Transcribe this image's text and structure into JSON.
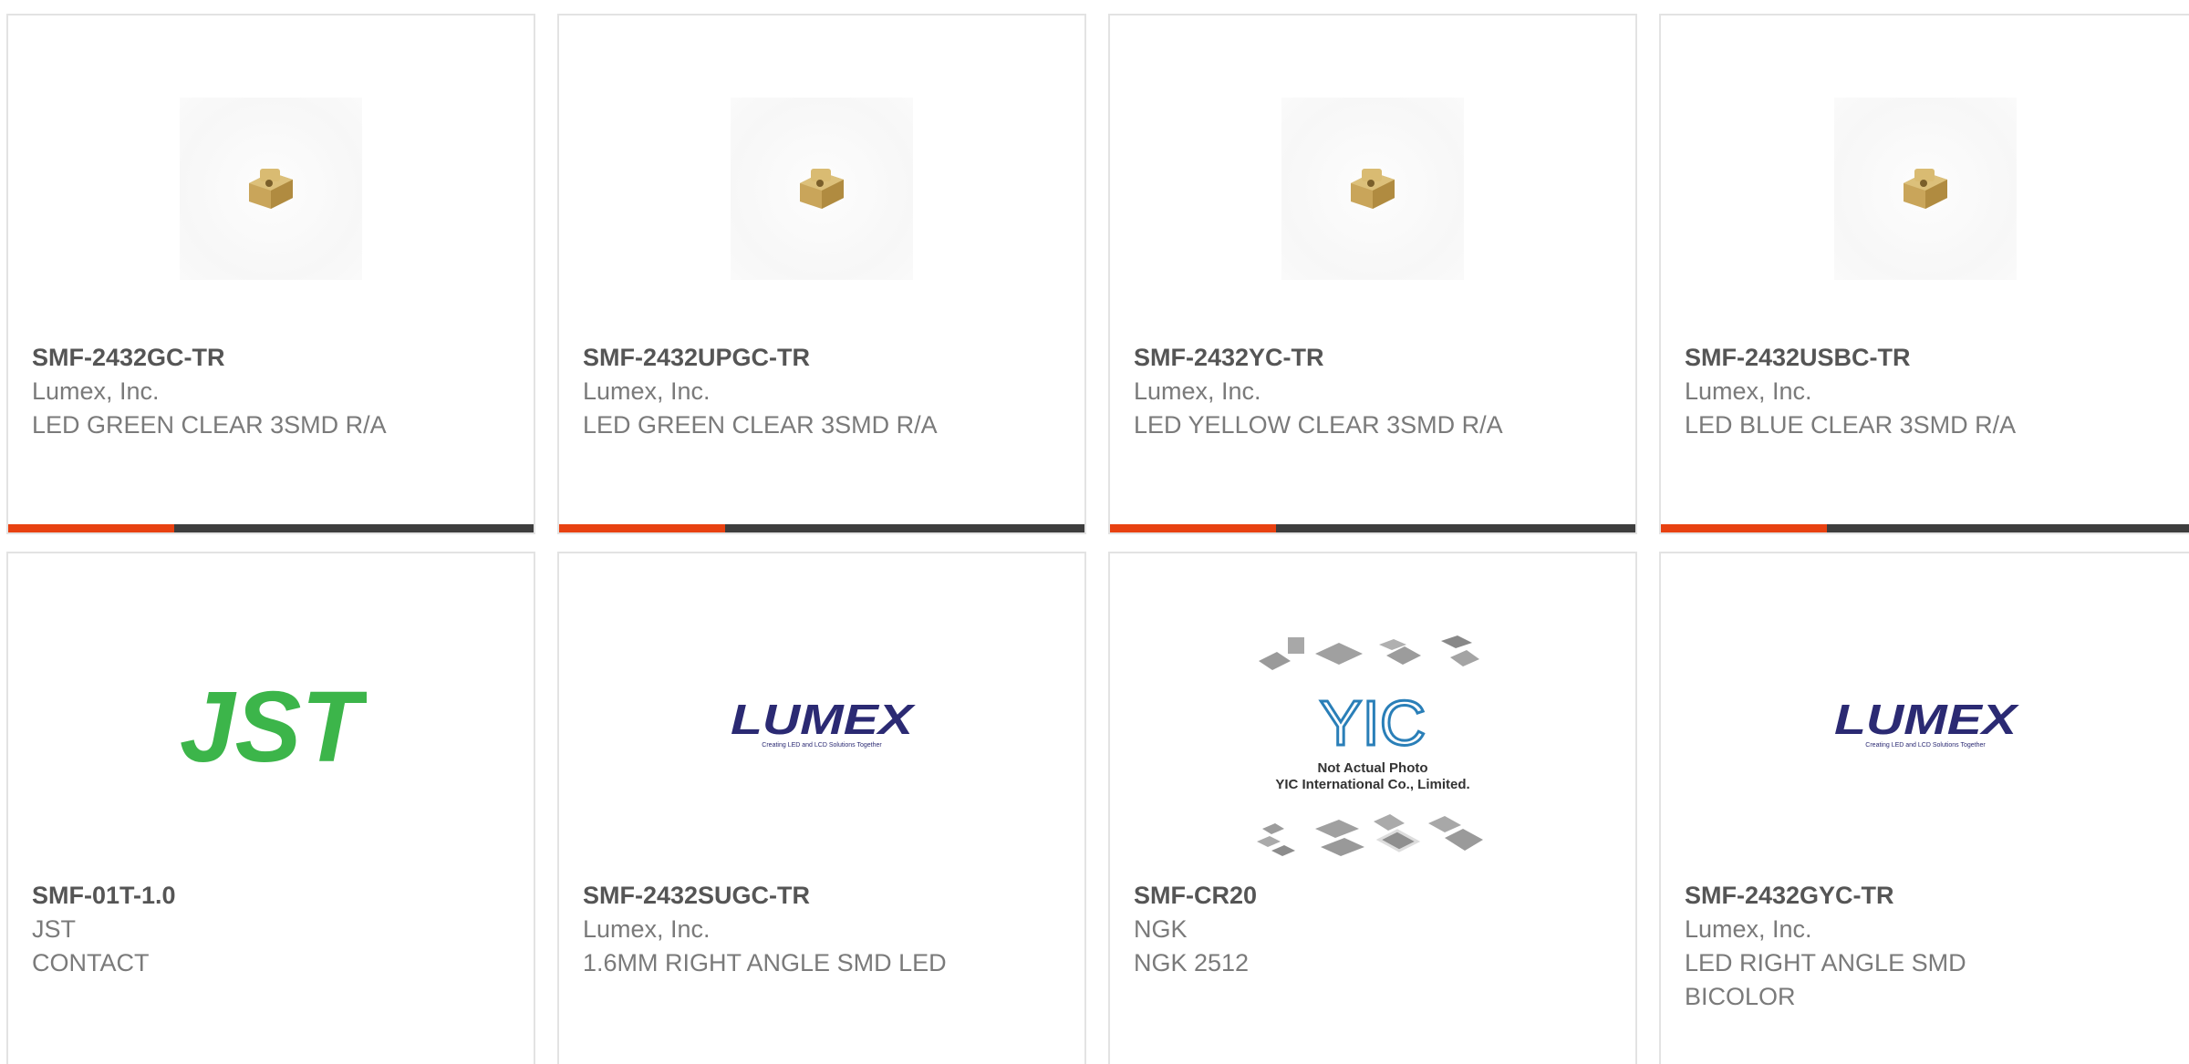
{
  "products": [
    {
      "part": "SMF-2432GC-TR",
      "mfr": "Lumex, Inc.",
      "desc": "LED GREEN CLEAR 3SMD R/A",
      "image": "led-smd-photo"
    },
    {
      "part": "SMF-2432UPGC-TR",
      "mfr": "Lumex, Inc.",
      "desc": "LED GREEN CLEAR 3SMD R/A",
      "image": "led-smd-photo"
    },
    {
      "part": "SMF-2432YC-TR",
      "mfr": "Lumex, Inc.",
      "desc": "LED YELLOW CLEAR 3SMD R/A",
      "image": "led-smd-photo"
    },
    {
      "part": "SMF-2432USBC-TR",
      "mfr": "Lumex, Inc.",
      "desc": "LED BLUE CLEAR 3SMD R/A",
      "image": "led-smd-photo"
    },
    {
      "part": "SMF-01T-1.0",
      "mfr": "JST",
      "desc": "CONTACT",
      "image": "jst-logo"
    },
    {
      "part": "SMF-2432SUGC-TR",
      "mfr": "Lumex, Inc.",
      "desc": "1.6MM RIGHT ANGLE SMD LED",
      "image": "lumex-logo"
    },
    {
      "part": "SMF-CR20",
      "mfr": "NGK",
      "desc": "NGK 2512",
      "image": "yic-placeholder"
    },
    {
      "part": "SMF-2432GYC-TR",
      "mfr": "Lumex, Inc.",
      "desc": "LED RIGHT ANGLE SMD BICOLOR",
      "image": "lumex-logo"
    }
  ],
  "logos": {
    "jst": "JST",
    "lumex": "LUMEX",
    "lumex_tagline": "Creating LED and LCD Solutions Together",
    "yic_mark": "YIC",
    "yic_line1": "Not Actual Photo",
    "yic_line2": "YIC International Co., Limited."
  },
  "colors": {
    "accent": "#e84111",
    "bar": "#3d3d3d",
    "border": "#e3e3e3",
    "part_text": "#555555",
    "meta_text": "#7a7a7a",
    "jst_green": "#3cb54a",
    "lumex_navy": "#2b2a73",
    "yic_blue": "#2a7fb8"
  }
}
